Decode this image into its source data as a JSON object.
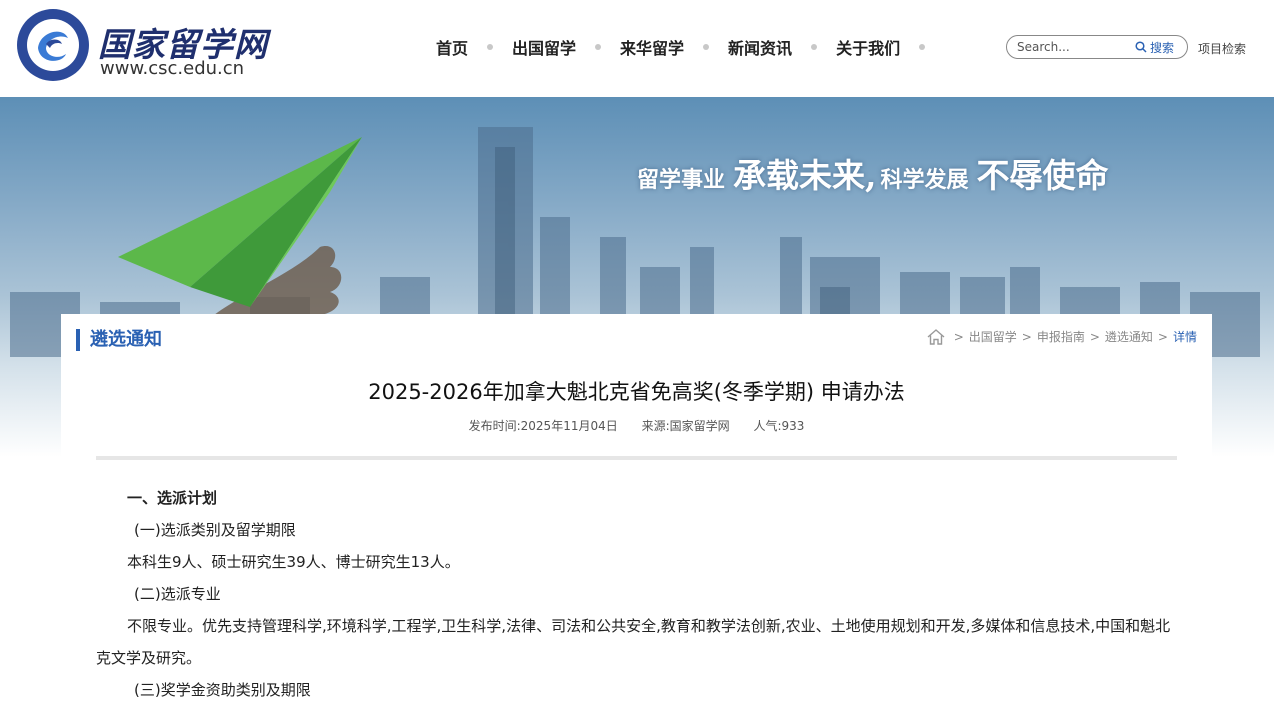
{
  "header": {
    "logo_cn": "国家留学网",
    "logo_url": "www.csc.edu.cn",
    "nav": [
      {
        "label": "首页"
      },
      {
        "label": "出国留学"
      },
      {
        "label": "来华留学"
      },
      {
        "label": "新闻资讯"
      },
      {
        "label": "关于我们"
      }
    ],
    "search": {
      "placeholder": "Search...",
      "button_label": "搜索"
    },
    "project_search_label": "项目检索"
  },
  "banner": {
    "slogan_part1": "留学事业",
    "slogan_part2": "承载未来,",
    "slogan_part3": "科学发展",
    "slogan_part4": "不辱使命"
  },
  "content": {
    "section_title": "遴选通知",
    "breadcrumb": [
      "出国留学",
      "申报指南",
      "遴选通知",
      "详情"
    ],
    "article": {
      "title": "2025-2026年加拿大魁北克省免高奖(冬季学期) 申请办法",
      "publish_time": "发布时间:2025年11月04日",
      "source": "来源:国家留学网",
      "views": "人气:933",
      "paragraphs": {
        "p1": "一、选派计划",
        "p2": "(一)选派类别及留学期限",
        "p3": "本科生9人、硕士研究生39人、博士研究生13人。",
        "p4": "(二)选派专业",
        "p5": "不限专业。优先支持管理科学,环境科学,工程学,卫生科学,法律、司法和公共安全,教育和教学法创新,农业、土地使用规划和开发,多媒体和信息技术,中国和魁北克文学及研究。",
        "p6": "(三)奖学金资助类别及期限"
      }
    }
  },
  "colors": {
    "accent": "#2a61b3",
    "brand_dark": "#1f2f6e",
    "plane_green": "#5cb84a"
  }
}
